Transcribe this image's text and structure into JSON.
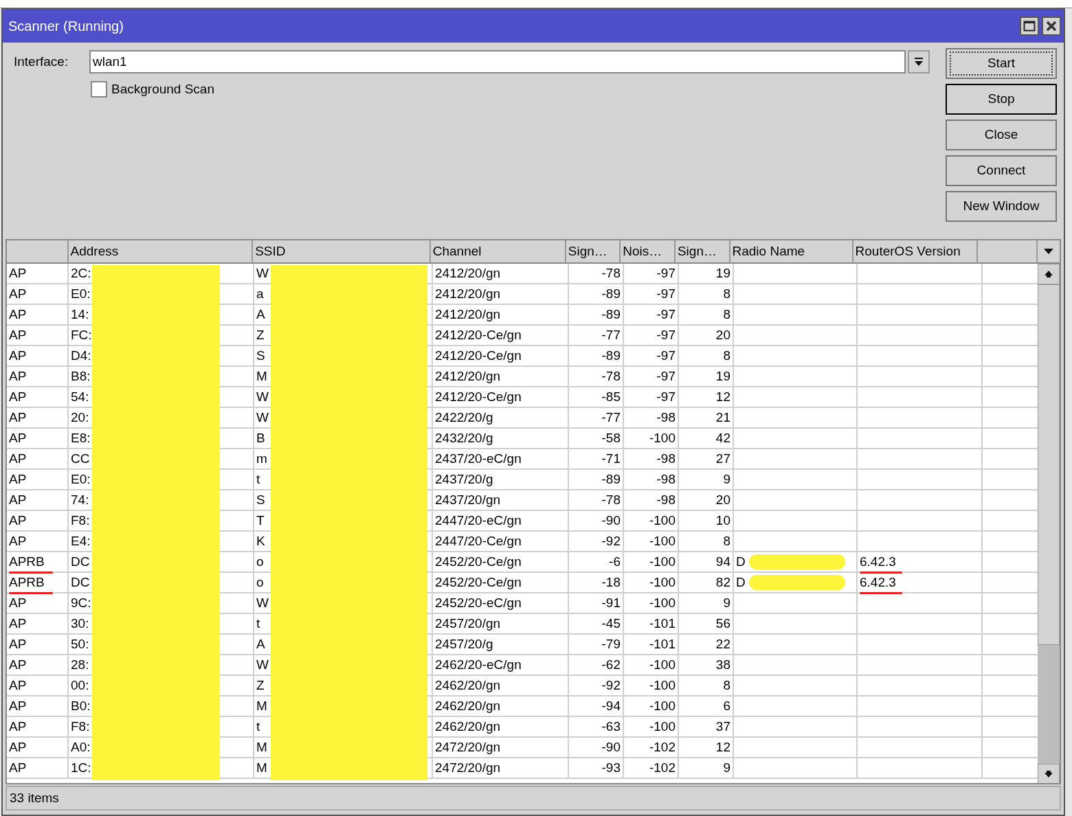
{
  "window": {
    "title": "Scanner (Running)"
  },
  "interface": {
    "label": "Interface:",
    "value": "wlan1"
  },
  "background_scan": {
    "label": "Background Scan",
    "checked": false
  },
  "buttons": [
    {
      "label": "Start",
      "focused": true
    },
    {
      "label": "Stop",
      "focused": false
    },
    {
      "label": "Close",
      "focused": false
    },
    {
      "label": "Connect",
      "focused": false
    },
    {
      "label": "New Window",
      "focused": false
    }
  ],
  "table": {
    "columns": [
      "",
      "Address",
      "SSID",
      "Channel",
      "Sign…",
      "Nois…",
      "Sign…",
      "Radio Name",
      "RouterOS Version"
    ],
    "rows": [
      {
        "type": "AP",
        "address": "2C:",
        "ssid": "W",
        "channel": "2412/20/gn",
        "signal": "-78",
        "noise": "-97",
        "snr": "19"
      },
      {
        "type": "AP",
        "address": "E0:",
        "ssid": "a",
        "channel": "2412/20/gn",
        "signal": "-89",
        "noise": "-97",
        "snr": "8"
      },
      {
        "type": "AP",
        "address": "14:",
        "ssid": "A",
        "channel": "2412/20/gn",
        "signal": "-89",
        "noise": "-97",
        "snr": "8"
      },
      {
        "type": "AP",
        "address": "FC:",
        "ssid": "Z",
        "channel": "2412/20-Ce/gn",
        "signal": "-77",
        "noise": "-97",
        "snr": "20"
      },
      {
        "type": "AP",
        "address": "D4:",
        "ssid": "S",
        "channel": "2412/20-Ce/gn",
        "signal": "-89",
        "noise": "-97",
        "snr": "8"
      },
      {
        "type": "AP",
        "address": "B8:",
        "ssid": "M",
        "channel": "2412/20/gn",
        "signal": "-78",
        "noise": "-97",
        "snr": "19"
      },
      {
        "type": "AP",
        "address": "54:",
        "ssid": "W",
        "channel": "2412/20-Ce/gn",
        "signal": "-85",
        "noise": "-97",
        "snr": "12"
      },
      {
        "type": "AP",
        "address": "20:",
        "ssid": "W",
        "channel": "2422/20/g",
        "signal": "-77",
        "noise": "-98",
        "snr": "21"
      },
      {
        "type": "AP",
        "address": "E8:",
        "ssid": "B",
        "channel": "2432/20/g",
        "signal": "-58",
        "noise": "-100",
        "snr": "42"
      },
      {
        "type": "AP",
        "address": "CC",
        "ssid": "m",
        "channel": "2437/20-eC/gn",
        "signal": "-71",
        "noise": "-98",
        "snr": "27"
      },
      {
        "type": "AP",
        "address": "E0:",
        "ssid": "t",
        "channel": "2437/20/g",
        "signal": "-89",
        "noise": "-98",
        "snr": "9"
      },
      {
        "type": "AP",
        "address": "74:",
        "ssid": "S",
        "channel": "2437/20/gn",
        "signal": "-78",
        "noise": "-98",
        "snr": "20"
      },
      {
        "type": "AP",
        "address": "F8:",
        "ssid": "T",
        "channel": "2447/20-eC/gn",
        "signal": "-90",
        "noise": "-100",
        "snr": "10"
      },
      {
        "type": "AP",
        "address": "E4:",
        "ssid": "K",
        "channel": "2447/20-Ce/gn",
        "signal": "-92",
        "noise": "-100",
        "snr": "8"
      },
      {
        "type": "APRB",
        "type_underlined": true,
        "address": "DC",
        "ssid": "o",
        "channel": "2452/20-Ce/gn",
        "signal": "-6",
        "noise": "-100",
        "snr": "94",
        "radio_name": "D",
        "radio_name_scribbled": true,
        "version": "6.42.3",
        "version_underlined": true
      },
      {
        "type": "APRB",
        "type_underlined": true,
        "address": "DC",
        "ssid": "o",
        "channel": "2452/20-Ce/gn",
        "signal": "-18",
        "noise": "-100",
        "snr": "82",
        "radio_name": "D",
        "radio_name_scribbled": true,
        "version": "6.42.3",
        "version_underlined": true
      },
      {
        "type": "AP",
        "address": "9C:",
        "ssid": "W",
        "channel": "2452/20-eC/gn",
        "signal": "-91",
        "noise": "-100",
        "snr": "9"
      },
      {
        "type": "AP",
        "address": "30:",
        "ssid": "t",
        "channel": "2457/20/gn",
        "signal": "-45",
        "noise": "-101",
        "snr": "56"
      },
      {
        "type": "AP",
        "address": "50:",
        "ssid": "A",
        "channel": "2457/20/g",
        "signal": "-79",
        "noise": "-101",
        "snr": "22"
      },
      {
        "type": "AP",
        "address": "28:",
        "ssid": "W",
        "channel": "2462/20-eC/gn",
        "signal": "-62",
        "noise": "-100",
        "snr": "38"
      },
      {
        "type": "AP",
        "address": "00:",
        "ssid": "Z",
        "channel": "2462/20/gn",
        "signal": "-92",
        "noise": "-100",
        "snr": "8"
      },
      {
        "type": "AP",
        "address": "B0:",
        "ssid": "M",
        "channel": "2462/20/gn",
        "signal": "-94",
        "noise": "-100",
        "snr": "6"
      },
      {
        "type": "AP",
        "address": "F8:",
        "ssid": "t",
        "channel": "2462/20/gn",
        "signal": "-63",
        "noise": "-100",
        "snr": "37"
      },
      {
        "type": "AP",
        "address": "A0:",
        "ssid": "M",
        "channel": "2472/20/gn",
        "signal": "-90",
        "noise": "-102",
        "snr": "12"
      },
      {
        "type": "AP",
        "address": "1C:",
        "ssid": "M",
        "channel": "2472/20/gn",
        "signal": "-93",
        "noise": "-102",
        "snr": "9"
      }
    ]
  },
  "status_bar": {
    "count": "33 items"
  }
}
